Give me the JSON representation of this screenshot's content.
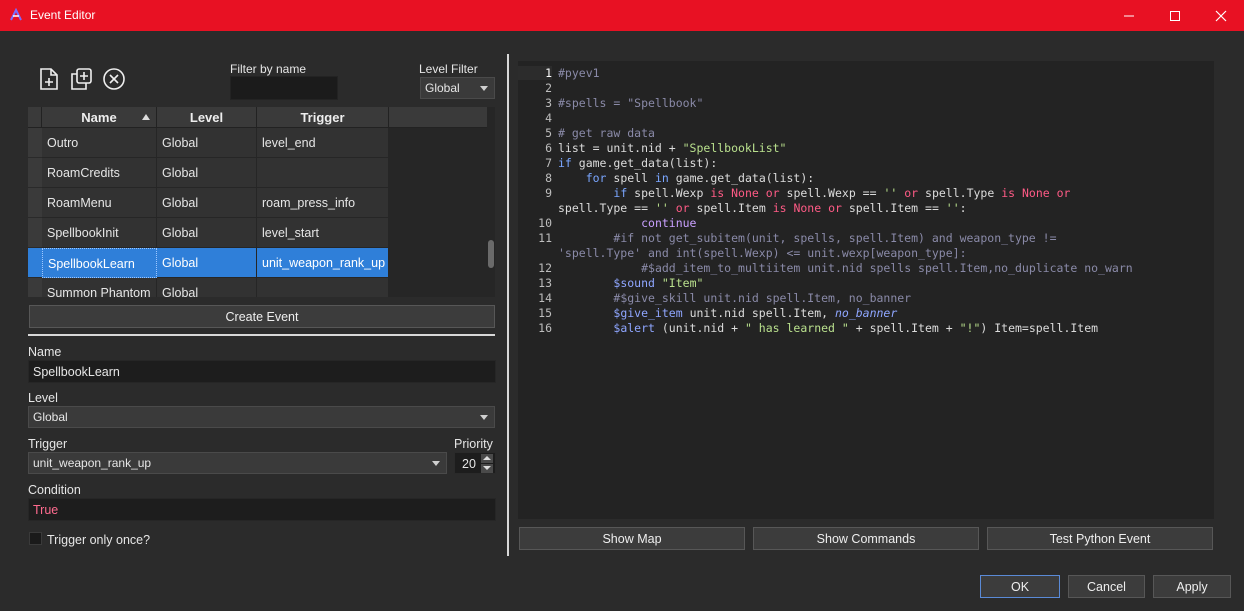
{
  "window": {
    "title": "Event Editor",
    "accent": "#e81123",
    "selection": "#2f7fd9",
    "controls": [
      "minimize-icon",
      "maximize-icon",
      "close-icon"
    ]
  },
  "toolbar": {
    "icons": [
      "new-event-icon",
      "duplicate-event-icon",
      "delete-event-icon"
    ],
    "filter_by_name_label": "Filter by name",
    "filter_by_name_value": "",
    "level_filter_label": "Level Filter",
    "level_filter_value": "Global"
  },
  "table": {
    "columns": [
      "Name",
      "Level",
      "Trigger"
    ],
    "sort_column": "Name",
    "rows": [
      {
        "name": "Outro",
        "level": "Global",
        "trigger": "level_end"
      },
      {
        "name": "RoamCredits",
        "level": "Global",
        "trigger": ""
      },
      {
        "name": "RoamMenu",
        "level": "Global",
        "trigger": "roam_press_info"
      },
      {
        "name": "SpellbookInit",
        "level": "Global",
        "trigger": "level_start"
      },
      {
        "name": "SpellbookLearn",
        "level": "Global",
        "trigger": "unit_weapon_rank_up"
      },
      {
        "name": "Summon Phantom",
        "level": "Global",
        "trigger": ""
      }
    ],
    "selected_index": 4
  },
  "create_event_label": "Create Event",
  "form": {
    "name_label": "Name",
    "name_value": "SpellbookLearn",
    "level_label": "Level",
    "level_value": "Global",
    "trigger_label": "Trigger",
    "trigger_value": "unit_weapon_rank_up",
    "priority_label": "Priority",
    "priority_value": "20",
    "condition_label": "Condition",
    "condition_value": "True",
    "once_label": "Trigger only once?",
    "once_checked": false
  },
  "editor": {
    "current_line": "1",
    "lines": [
      {
        "n": "1",
        "segs": [
          [
            "cm",
            "#pyev1"
          ]
        ]
      },
      {
        "n": "2",
        "segs": []
      },
      {
        "n": "3",
        "segs": [
          [
            "cm",
            "#spells = \"Spellbook\""
          ]
        ]
      },
      {
        "n": "4",
        "segs": []
      },
      {
        "n": "5",
        "segs": [
          [
            "cm",
            "# get raw data"
          ]
        ]
      },
      {
        "n": "6",
        "segs": [
          [
            "",
            "list = unit.nid + "
          ],
          [
            "str",
            "\"SpellbookList\""
          ]
        ]
      },
      {
        "n": "7",
        "segs": [
          [
            "kw",
            "if"
          ],
          [
            "",
            " game.get_data(list):"
          ]
        ]
      },
      {
        "n": "8",
        "segs": [
          [
            "",
            "    "
          ],
          [
            "kw",
            "for"
          ],
          [
            "",
            " spell "
          ],
          [
            "kw",
            "in"
          ],
          [
            "",
            " game.get_data(list):"
          ]
        ]
      },
      {
        "n": "9",
        "segs": [
          [
            "",
            "        "
          ],
          [
            "kw",
            "if"
          ],
          [
            "",
            " spell.Wexp "
          ],
          [
            "op",
            "is None or"
          ],
          [
            "",
            " spell.Wexp == "
          ],
          [
            "str",
            "''"
          ],
          [
            "",
            " "
          ],
          [
            "op",
            "or"
          ],
          [
            "",
            " spell.Type "
          ],
          [
            "op",
            "is None or"
          ]
        ]
      },
      {
        "n": "",
        "segs": [
          [
            "",
            "spell.Type == "
          ],
          [
            "str",
            "''"
          ],
          [
            "",
            " "
          ],
          [
            "op",
            "or"
          ],
          [
            "",
            " spell.Item "
          ],
          [
            "op",
            "is None or"
          ],
          [
            "",
            " spell.Item == "
          ],
          [
            "str",
            "''"
          ],
          [
            "",
            ":"
          ]
        ]
      },
      {
        "n": "10",
        "segs": [
          [
            "",
            "            "
          ],
          [
            "cont",
            "continue"
          ]
        ]
      },
      {
        "n": "11",
        "segs": [
          [
            "",
            "        "
          ],
          [
            "cm",
            "#if not get_subitem(unit, spells, spell.Item) and weapon_type !="
          ]
        ]
      },
      {
        "n": "",
        "segs": [
          [
            "cm",
            "'spell.Type' and int(spell.Wexp) <= unit.wexp[weapon_type]:"
          ]
        ]
      },
      {
        "n": "12",
        "segs": [
          [
            "",
            "            "
          ],
          [
            "cm",
            "#$add_item_to_multiitem unit.nid spells spell.Item,no_duplicate no_warn"
          ]
        ]
      },
      {
        "n": "13",
        "segs": [
          [
            "",
            "        "
          ],
          [
            "cmd",
            "$sound"
          ],
          [
            "",
            " "
          ],
          [
            "str",
            "\"Item\""
          ]
        ]
      },
      {
        "n": "14",
        "segs": [
          [
            "",
            "        "
          ],
          [
            "cm",
            "#$give_skill unit.nid spell.Item, no_banner"
          ]
        ]
      },
      {
        "n": "15",
        "segs": [
          [
            "",
            "        "
          ],
          [
            "cmd",
            "$give_item"
          ],
          [
            "",
            " unit.nid spell.Item, "
          ],
          [
            "it",
            "no_banner"
          ]
        ]
      },
      {
        "n": "16",
        "segs": [
          [
            "",
            "        "
          ],
          [
            "cmd",
            "$alert"
          ],
          [
            "",
            " (unit.nid + "
          ],
          [
            "str",
            "\" has learned \""
          ],
          [
            "",
            " + spell.Item + "
          ],
          [
            "str",
            "\"!\""
          ],
          [
            "",
            ") Item=spell.Item"
          ]
        ]
      }
    ]
  },
  "editor_buttons": {
    "show_map": "Show Map",
    "show_commands": "Show Commands",
    "test_python": "Test Python Event"
  },
  "dialog_buttons": {
    "ok": "OK",
    "cancel": "Cancel",
    "apply": "Apply"
  }
}
